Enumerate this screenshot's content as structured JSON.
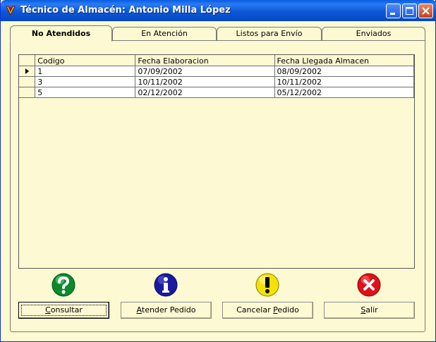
{
  "window": {
    "title": "Técnico de Almacén: Antonio Milla López",
    "colors": {
      "titlebar": "#0a5de0",
      "body": "#fdf9d2"
    }
  },
  "tabs": [
    {
      "label": "No Atendidos",
      "active": true
    },
    {
      "label": "En Atención",
      "active": false
    },
    {
      "label": "Listos para Envío",
      "active": false
    },
    {
      "label": "Enviados",
      "active": false
    }
  ],
  "grid": {
    "columns": [
      "Codigo",
      "Fecha Elaboracion",
      "Fecha Llegada Almacen"
    ],
    "rows": [
      {
        "codigo": "1",
        "fecha_elaboracion": "07/09/2002",
        "fecha_llegada": "08/09/2002",
        "current": true
      },
      {
        "codigo": "3",
        "fecha_elaboracion": "10/11/2002",
        "fecha_llegada": "10/11/2002",
        "current": false
      },
      {
        "codigo": "5",
        "fecha_elaboracion": "02/12/2002",
        "fecha_llegada": "05/12/2002",
        "current": false
      }
    ]
  },
  "actions": [
    {
      "icon": "question-icon",
      "color": "#0a8a2a",
      "pre": "",
      "key": "C",
      "post": "onsultar"
    },
    {
      "icon": "info-icon",
      "color": "#1a1aa0",
      "pre": "",
      "key": "A",
      "post": "tender Pedido"
    },
    {
      "icon": "warning-icon",
      "color": "#f2e20a",
      "pre": "Cancelar ",
      "key": "P",
      "post": "edido"
    },
    {
      "icon": "close-circle-icon",
      "color": "#e0101a",
      "pre": "",
      "key": "S",
      "post": "alir"
    }
  ]
}
